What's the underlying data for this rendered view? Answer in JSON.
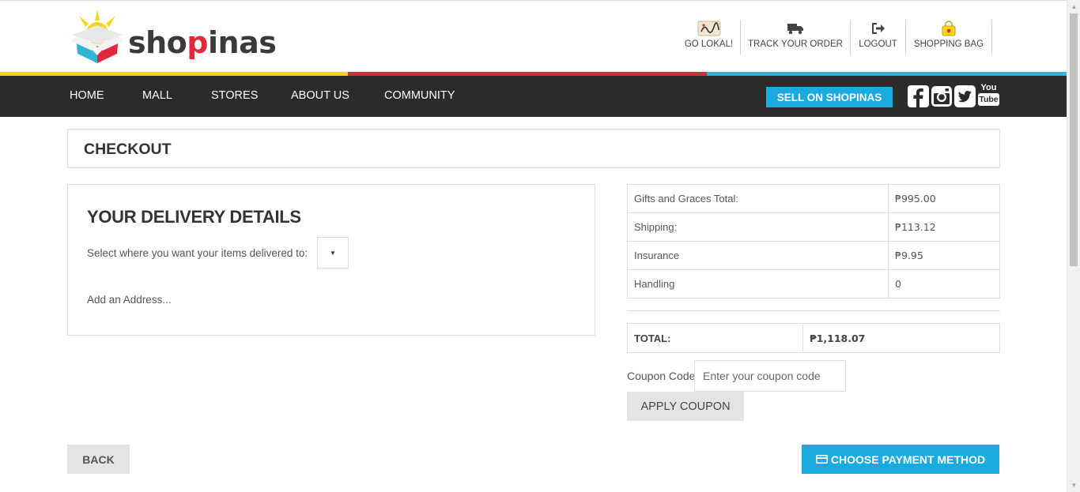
{
  "brand": {
    "name_prefix": "sho",
    "name_accent": "p",
    "name_suffix": "inas"
  },
  "top_links": [
    {
      "label": "GO LOKAL!",
      "icon": "go-lokal-badge-icon"
    },
    {
      "label": "TRACK YOUR ORDER",
      "icon": "truck-icon"
    },
    {
      "label": "LOGOUT",
      "icon": "logout-icon"
    },
    {
      "label": "SHOPPING BAG",
      "icon": "shopping-bag-icon"
    }
  ],
  "stripe_colors": [
    "#f5d617",
    "#e0293e",
    "#33b4d4"
  ],
  "nav": {
    "items": [
      "HOME",
      "MALL",
      "STORES",
      "ABOUT US",
      "COMMUNITY"
    ],
    "sell_label": "SELL ON SHOPINAS",
    "social": [
      "facebook-icon",
      "instagram-icon",
      "twitter-icon",
      "youtube-icon"
    ],
    "youtube_top": "You",
    "youtube_bottom": "Tube"
  },
  "checkout": {
    "title": "CHECKOUT"
  },
  "delivery": {
    "title": "YOUR DELIVERY DETAILS",
    "prompt": "Select where you want your items delivered to:",
    "selected_value": "",
    "add_address": "Add an Address..."
  },
  "summary": {
    "rows": [
      {
        "label": "Gifts and Graces Total:",
        "value": "₱995.00"
      },
      {
        "label": "Shipping:",
        "value": "₱113.12"
      },
      {
        "label": "Insurance",
        "value": "₱9.95"
      },
      {
        "label": "Handling",
        "value": "0"
      }
    ],
    "total_label": "TOTAL:",
    "total_value": "₱1,118.07"
  },
  "coupon": {
    "label": "Coupon Code",
    "placeholder": "Enter your coupon code",
    "apply_label": "APPLY COUPON"
  },
  "actions": {
    "back_label": "BACK",
    "payment_label": "CHOOSE PAYMENT METHOD"
  },
  "colors": {
    "accent": "#19aadf",
    "nav_bg": "#2b2b2b",
    "button_gray": "#e4e4e4"
  }
}
